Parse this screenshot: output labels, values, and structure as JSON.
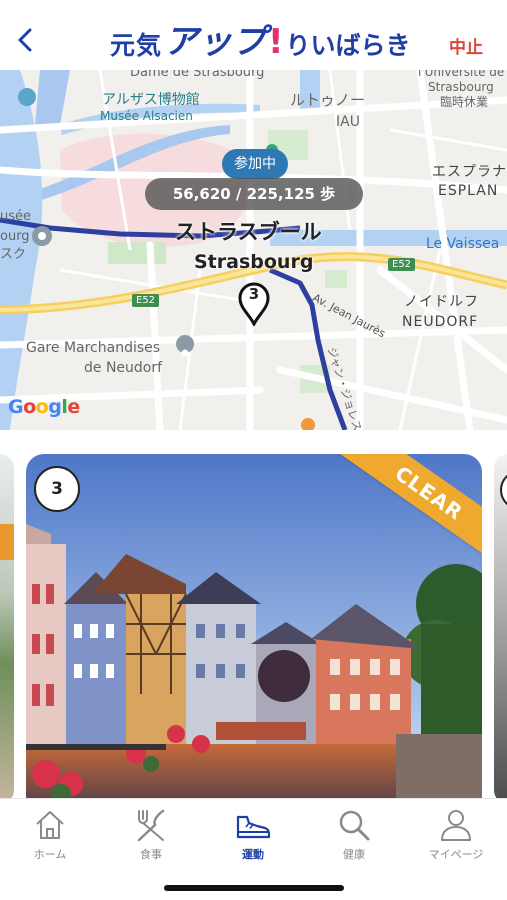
{
  "header": {
    "logo_part1": "元気",
    "logo_part2": "アップ",
    "logo_part3": "!",
    "logo_part4": "りいばらき",
    "stop_label": "中止"
  },
  "map": {
    "participating_badge": "参加中",
    "step_counter": "56,620 / 225,125 歩",
    "marker_number": "3",
    "labels": {
      "dame": "Dame de Strasbourg",
      "alsace_jp": "アルザス博物館",
      "alsace_fr": "Musée Alsacien",
      "lutoono": "ルトゥノー",
      "iau": "IAU",
      "univ1": "l'Université de",
      "univ2": "Strasbourg",
      "univ3": "臨時休業",
      "esplanade_jp": "エスプラナ",
      "esplanade_fr": "ESPLAN",
      "musee_frag": "usée",
      "bourg_frag": "ourg",
      "sku_frag": "スク",
      "strasbourg_jp": "ストラスブール",
      "strasbourg_en": "Strasbourg",
      "vaisseau": "Le Vaissea",
      "e52_a": "E52",
      "e52_b": "E52",
      "jean_jaures": "Av. Jean Jaurès",
      "jaures_jp": "ジャン・ジョレス通り",
      "neudorf_jp": "ノイドルフ",
      "neudorf_fr": "NEUDORF",
      "gare1": "Gare Marchandises",
      "gare2": "de Neudorf",
      "google": "Google"
    }
  },
  "card": {
    "number": "3",
    "badge": "CLEAR"
  },
  "tabs": [
    {
      "label": "ホーム",
      "icon": "home-icon",
      "active": false
    },
    {
      "label": "食事",
      "icon": "fork-knife-icon",
      "active": false
    },
    {
      "label": "運動",
      "icon": "sneaker-icon",
      "active": true
    },
    {
      "label": "健康",
      "icon": "search-icon",
      "active": false
    },
    {
      "label": "マイページ",
      "icon": "person-icon",
      "active": false
    }
  ],
  "colors": {
    "brand_blue": "#1f3fa6",
    "brand_pink": "#e5306b",
    "stop_red": "#e0453a",
    "badge_blue": "#2e79b4",
    "clear_orange": "#efa92f"
  }
}
